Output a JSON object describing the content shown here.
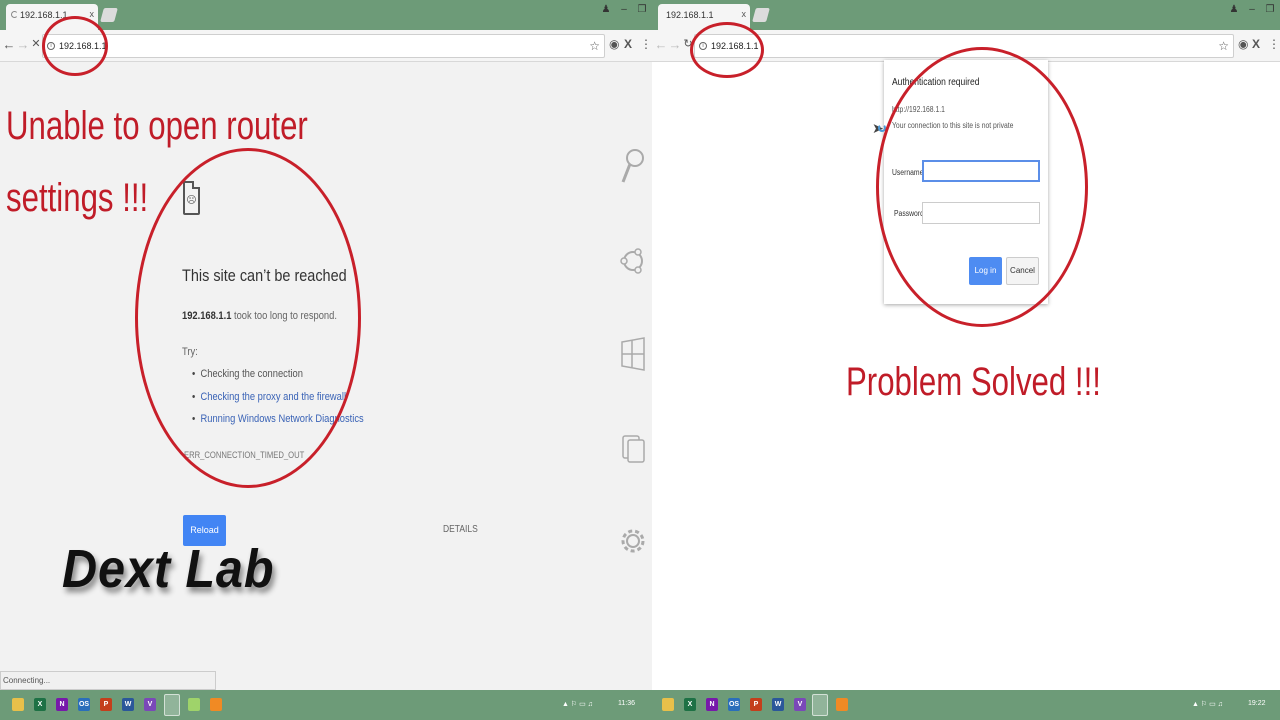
{
  "left": {
    "tab": {
      "title": "192.168.1.1",
      "close": "x"
    },
    "url": "192.168.1.1",
    "annotation": [
      "Unable to open router",
      "settings !!!"
    ],
    "error": {
      "title": "This site can’t be reached",
      "host": "192.168.1.1",
      "desc_rest": " took too long to respond.",
      "try": "Try:",
      "suggestions": [
        "Checking the connection",
        "Checking the proxy and the firewall",
        "Running Windows Network Diagnostics"
      ],
      "code": "ERR_CONNECTION_TIMED_OUT",
      "reload": "Reload",
      "details": "DETAILS"
    },
    "watermark": "Dext Lab",
    "status": "Connecting...",
    "clock": "11:36",
    "side_icons": [
      "magnifier-icon",
      "ubuntu-icon",
      "windows-logo-icon",
      "copy-icon",
      "gear-icon"
    ]
  },
  "right": {
    "tab": {
      "title": "192.168.1.1",
      "close": "x"
    },
    "url": "192.168.1.1",
    "dialog": {
      "title": "Authentication required",
      "url": "http://192.168.1.1",
      "note": "Your connection to this site is not private",
      "username_label": "Username",
      "password_label": "Password",
      "login": "Log in",
      "cancel": "Cancel"
    },
    "annotation": "Problem Solved !!!",
    "clock": "19:22"
  },
  "taskbar_apps": [
    "folder",
    "X",
    "N",
    "OS",
    "P",
    "W",
    "V",
    "chrome",
    "picture",
    "vlc"
  ],
  "colors": {
    "taskbar": "#6d9b78",
    "annotation_red": "#c8202a",
    "accent_blue": "#4285f4"
  }
}
